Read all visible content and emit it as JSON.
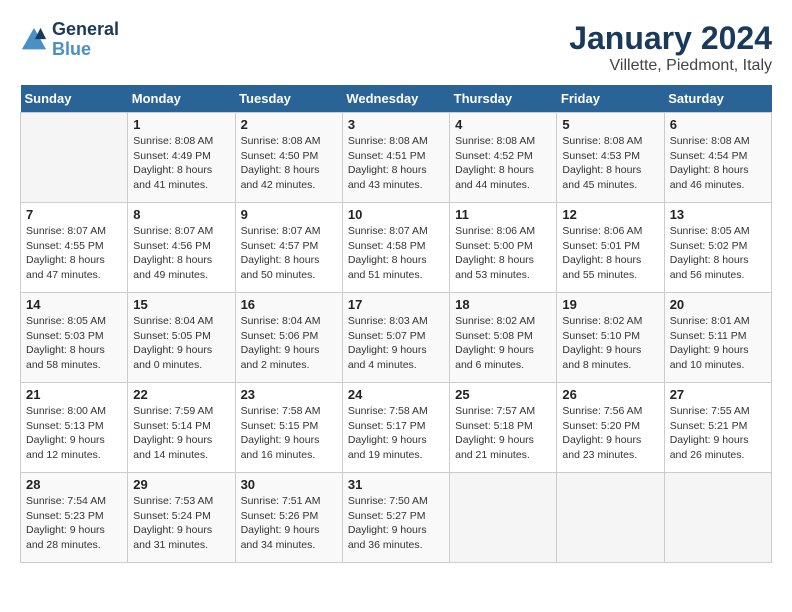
{
  "header": {
    "logo_line1": "General",
    "logo_line2": "Blue",
    "month": "January 2024",
    "location": "Villette, Piedmont, Italy"
  },
  "weekdays": [
    "Sunday",
    "Monday",
    "Tuesday",
    "Wednesday",
    "Thursday",
    "Friday",
    "Saturday"
  ],
  "weeks": [
    [
      {
        "day": "",
        "info": ""
      },
      {
        "day": "1",
        "info": "Sunrise: 8:08 AM\nSunset: 4:49 PM\nDaylight: 8 hours\nand 41 minutes."
      },
      {
        "day": "2",
        "info": "Sunrise: 8:08 AM\nSunset: 4:50 PM\nDaylight: 8 hours\nand 42 minutes."
      },
      {
        "day": "3",
        "info": "Sunrise: 8:08 AM\nSunset: 4:51 PM\nDaylight: 8 hours\nand 43 minutes."
      },
      {
        "day": "4",
        "info": "Sunrise: 8:08 AM\nSunset: 4:52 PM\nDaylight: 8 hours\nand 44 minutes."
      },
      {
        "day": "5",
        "info": "Sunrise: 8:08 AM\nSunset: 4:53 PM\nDaylight: 8 hours\nand 45 minutes."
      },
      {
        "day": "6",
        "info": "Sunrise: 8:08 AM\nSunset: 4:54 PM\nDaylight: 8 hours\nand 46 minutes."
      }
    ],
    [
      {
        "day": "7",
        "info": "Sunrise: 8:07 AM\nSunset: 4:55 PM\nDaylight: 8 hours\nand 47 minutes."
      },
      {
        "day": "8",
        "info": "Sunrise: 8:07 AM\nSunset: 4:56 PM\nDaylight: 8 hours\nand 49 minutes."
      },
      {
        "day": "9",
        "info": "Sunrise: 8:07 AM\nSunset: 4:57 PM\nDaylight: 8 hours\nand 50 minutes."
      },
      {
        "day": "10",
        "info": "Sunrise: 8:07 AM\nSunset: 4:58 PM\nDaylight: 8 hours\nand 51 minutes."
      },
      {
        "day": "11",
        "info": "Sunrise: 8:06 AM\nSunset: 5:00 PM\nDaylight: 8 hours\nand 53 minutes."
      },
      {
        "day": "12",
        "info": "Sunrise: 8:06 AM\nSunset: 5:01 PM\nDaylight: 8 hours\nand 55 minutes."
      },
      {
        "day": "13",
        "info": "Sunrise: 8:05 AM\nSunset: 5:02 PM\nDaylight: 8 hours\nand 56 minutes."
      }
    ],
    [
      {
        "day": "14",
        "info": "Sunrise: 8:05 AM\nSunset: 5:03 PM\nDaylight: 8 hours\nand 58 minutes."
      },
      {
        "day": "15",
        "info": "Sunrise: 8:04 AM\nSunset: 5:05 PM\nDaylight: 9 hours\nand 0 minutes."
      },
      {
        "day": "16",
        "info": "Sunrise: 8:04 AM\nSunset: 5:06 PM\nDaylight: 9 hours\nand 2 minutes."
      },
      {
        "day": "17",
        "info": "Sunrise: 8:03 AM\nSunset: 5:07 PM\nDaylight: 9 hours\nand 4 minutes."
      },
      {
        "day": "18",
        "info": "Sunrise: 8:02 AM\nSunset: 5:08 PM\nDaylight: 9 hours\nand 6 minutes."
      },
      {
        "day": "19",
        "info": "Sunrise: 8:02 AM\nSunset: 5:10 PM\nDaylight: 9 hours\nand 8 minutes."
      },
      {
        "day": "20",
        "info": "Sunrise: 8:01 AM\nSunset: 5:11 PM\nDaylight: 9 hours\nand 10 minutes."
      }
    ],
    [
      {
        "day": "21",
        "info": "Sunrise: 8:00 AM\nSunset: 5:13 PM\nDaylight: 9 hours\nand 12 minutes."
      },
      {
        "day": "22",
        "info": "Sunrise: 7:59 AM\nSunset: 5:14 PM\nDaylight: 9 hours\nand 14 minutes."
      },
      {
        "day": "23",
        "info": "Sunrise: 7:58 AM\nSunset: 5:15 PM\nDaylight: 9 hours\nand 16 minutes."
      },
      {
        "day": "24",
        "info": "Sunrise: 7:58 AM\nSunset: 5:17 PM\nDaylight: 9 hours\nand 19 minutes."
      },
      {
        "day": "25",
        "info": "Sunrise: 7:57 AM\nSunset: 5:18 PM\nDaylight: 9 hours\nand 21 minutes."
      },
      {
        "day": "26",
        "info": "Sunrise: 7:56 AM\nSunset: 5:20 PM\nDaylight: 9 hours\nand 23 minutes."
      },
      {
        "day": "27",
        "info": "Sunrise: 7:55 AM\nSunset: 5:21 PM\nDaylight: 9 hours\nand 26 minutes."
      }
    ],
    [
      {
        "day": "28",
        "info": "Sunrise: 7:54 AM\nSunset: 5:23 PM\nDaylight: 9 hours\nand 28 minutes."
      },
      {
        "day": "29",
        "info": "Sunrise: 7:53 AM\nSunset: 5:24 PM\nDaylight: 9 hours\nand 31 minutes."
      },
      {
        "day": "30",
        "info": "Sunrise: 7:51 AM\nSunset: 5:26 PM\nDaylight: 9 hours\nand 34 minutes."
      },
      {
        "day": "31",
        "info": "Sunrise: 7:50 AM\nSunset: 5:27 PM\nDaylight: 9 hours\nand 36 minutes."
      },
      {
        "day": "",
        "info": ""
      },
      {
        "day": "",
        "info": ""
      },
      {
        "day": "",
        "info": ""
      }
    ]
  ]
}
